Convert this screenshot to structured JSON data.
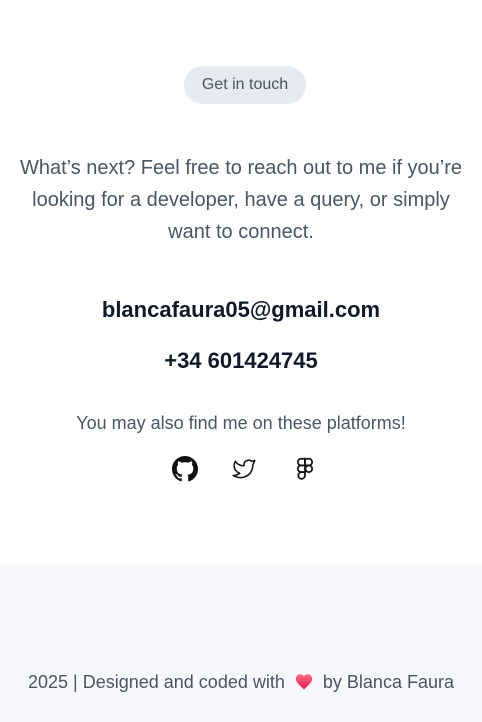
{
  "contact": {
    "badge_label": "Get in touch",
    "intro": "What’s next? Feel free to reach out to me if you’re looking for a developer, have a query, or simply want to connect.",
    "email": "blancafaura05@gmail.com",
    "phone": "+34 601424745",
    "platforms_text": "You may also find me on these platforms!",
    "socials": [
      {
        "icon": "github-icon"
      },
      {
        "icon": "twitter-icon"
      },
      {
        "icon": "figma-icon"
      }
    ]
  },
  "footer": {
    "text_before": "2025 | Designed and coded with",
    "heart_icon": "heart-icon",
    "heart_color": "#f43f6e",
    "text_after": "by Blanca Faura"
  },
  "colors": {
    "badge_bg": "#e5e9f0",
    "body_text": "#4b5563",
    "heading_text": "#111827",
    "footer_bg": "#f6f7fa"
  }
}
